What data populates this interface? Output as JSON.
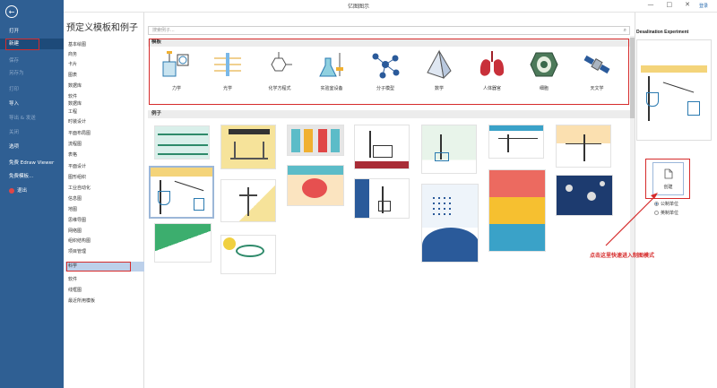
{
  "window": {
    "title": "亿图图示",
    "login": "登录",
    "controls": [
      "—",
      "□",
      "✕"
    ]
  },
  "sidebar": {
    "items": [
      {
        "label": "打开",
        "state": "normal"
      },
      {
        "label": "新建",
        "state": "active"
      },
      {
        "label": "保存",
        "state": "dim"
      },
      {
        "label": "另存为",
        "state": "dim"
      },
      {
        "label": "打印",
        "state": "dim"
      },
      {
        "label": "导入",
        "state": "normal"
      },
      {
        "label": "导出 & 发送",
        "state": "dim"
      },
      {
        "label": "关闭",
        "state": "dim"
      },
      {
        "label": "选项",
        "state": "normal"
      },
      {
        "label": "免费 Edraw Viewer",
        "state": "normal"
      },
      {
        "label": "免费模板...",
        "state": "normal"
      },
      {
        "label": "退出",
        "state": "normal"
      }
    ]
  },
  "main": {
    "heading": "预定义模板和例子",
    "search_placeholder": "搜索例子...",
    "categories": [
      "基本绘图",
      "商务",
      "卡片",
      "图表",
      "数据库",
      "软件",
      "数据库",
      "工程",
      "时装设计",
      "平面布局图",
      "流程图",
      "表格",
      "平面设计",
      "图形组织",
      "工业自动化",
      "信息图",
      "地图",
      "思维导图",
      "网络图",
      "组织结构图",
      "项目管理",
      "科学",
      "软件",
      "线框图",
      "最近所用模板"
    ],
    "selected_category": "科学",
    "templates_header": "模板",
    "templates": [
      "力学",
      "光学",
      "化学方程式",
      "实验室设备",
      "分子模型",
      "数学",
      "人体器官",
      "细胞",
      "天文学"
    ],
    "examples_header": "例子"
  },
  "right_panel": {
    "preview_title": "Desalination Experiment",
    "create_label": "创建",
    "units": [
      "公制单位",
      "英制单位"
    ],
    "selected_unit": "公制单位"
  },
  "annotation": "点击这里快速进入制图模式",
  "colors": {
    "sidebar": "#2f5f93",
    "highlight": "#d62b2b",
    "selected": "#bcd0ea"
  }
}
